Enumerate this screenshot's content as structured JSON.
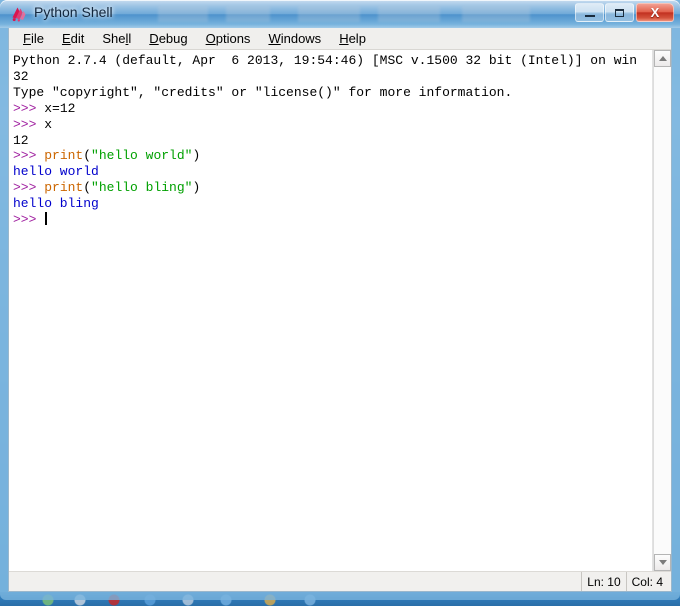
{
  "window": {
    "title": "Python Shell",
    "icon": "python-idle-icon",
    "controls": {
      "minimize_label": "Minimize",
      "maximize_label": "Maximize",
      "close_label": "X"
    }
  },
  "menubar": {
    "items": [
      {
        "name": "file",
        "pre": "",
        "accel": "F",
        "post": "ile"
      },
      {
        "name": "edit",
        "pre": "",
        "accel": "E",
        "post": "dit"
      },
      {
        "name": "shell",
        "pre": "She",
        "accel": "l",
        "post": "l"
      },
      {
        "name": "debug",
        "pre": "",
        "accel": "D",
        "post": "ebug"
      },
      {
        "name": "options",
        "pre": "",
        "accel": "O",
        "post": "ptions"
      },
      {
        "name": "windows",
        "pre": "",
        "accel": "W",
        "post": "indows"
      },
      {
        "name": "help",
        "pre": "",
        "accel": "H",
        "post": "elp"
      }
    ]
  },
  "shell": {
    "lines": [
      [
        {
          "t": "plain",
          "s": "Python 2.7.4 (default, Apr  6 2013, 19:54:46) [MSC v.1500 32 bit (Intel)] on win"
        }
      ],
      [
        {
          "t": "plain",
          "s": "32"
        }
      ],
      [
        {
          "t": "plain",
          "s": "Type \"copyright\", \"credits\" or \"license()\" for more information."
        }
      ],
      [
        {
          "t": "prompt",
          "s": ">>> "
        },
        {
          "t": "plain",
          "s": "x=12"
        }
      ],
      [
        {
          "t": "prompt",
          "s": ">>> "
        },
        {
          "t": "plain",
          "s": "x"
        }
      ],
      [
        {
          "t": "plain",
          "s": "12"
        }
      ],
      [
        {
          "t": "prompt",
          "s": ">>> "
        },
        {
          "t": "keyword",
          "s": "print"
        },
        {
          "t": "plain",
          "s": "("
        },
        {
          "t": "string",
          "s": "\"hello world\""
        },
        {
          "t": "plain",
          "s": ")"
        }
      ],
      [
        {
          "t": "output",
          "s": "hello world"
        }
      ],
      [
        {
          "t": "prompt",
          "s": ">>> "
        },
        {
          "t": "keyword",
          "s": "print"
        },
        {
          "t": "plain",
          "s": "("
        },
        {
          "t": "string",
          "s": "\"hello bling\""
        },
        {
          "t": "plain",
          "s": ")"
        }
      ],
      [
        {
          "t": "output",
          "s": "hello bling"
        }
      ],
      [
        {
          "t": "prompt",
          "s": ">>> "
        },
        {
          "t": "caret",
          "s": ""
        }
      ]
    ],
    "colors": {
      "prompt": "#a020a0",
      "keyword": "#cc6600",
      "string": "#00a000",
      "output": "#0000cc",
      "plain": "#000000",
      "background": "#ffffff"
    }
  },
  "scrollbar": {
    "up_arrow": "scroll-up-arrow",
    "down_arrow": "scroll-down-arrow"
  },
  "statusbar": {
    "line_label": "Ln: 10",
    "col_label": "Col: 4"
  }
}
